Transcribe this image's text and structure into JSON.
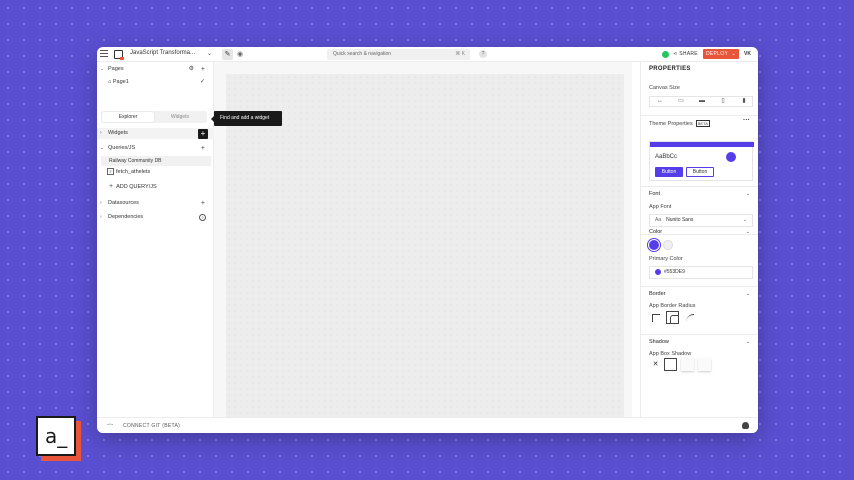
{
  "topbar": {
    "app_name": "JavaScript Transforma...",
    "search_placeholder": "Quick search & navigation",
    "search_shortcut": "⌘ K",
    "share_label": "SHARE",
    "deploy_label": "DEPLOY",
    "user_initials": "VK"
  },
  "sidebar": {
    "pages_label": "Pages",
    "page1_label": "Page1",
    "tab_explorer": "Explorer",
    "tab_widgets": "Widgets",
    "widgets_label": "Widgets",
    "tooltip": "Find and add a widget",
    "queries_label": "Queries/JS",
    "railway_label": "Railway Community DB",
    "fetch_label": "fetch_athelets",
    "add_query_label": "ADD QUERY/JS",
    "datasources_label": "Datasources",
    "dependencies_label": "Dependencies"
  },
  "properties": {
    "title": "PROPERTIES",
    "canvas_size_label": "Canvas Size",
    "theme_properties_label": "Theme Properties",
    "beta_badge": "BETA",
    "theme_sample_text": "AaBbCc",
    "theme_button_filled": "Button",
    "theme_button_outline": "Button",
    "font_section": "Font",
    "app_font_label": "App Font",
    "app_font_prefix": "Aa",
    "app_font_value": "Nunito Sans",
    "color_section": "Color",
    "primary_color_label": "Primary Color",
    "primary_color_value": "#553DE9",
    "border_section": "Border",
    "border_radius_label": "App Border Radius",
    "shadow_section": "Shadow",
    "box_shadow_label": "App Box Shadow",
    "primary_color": "#553de9"
  },
  "bottombar": {
    "connect_git_label": "CONNECT GIT (BETA)"
  },
  "brand": {
    "logo_text": "a_",
    "accent_color": "#e9553a"
  }
}
